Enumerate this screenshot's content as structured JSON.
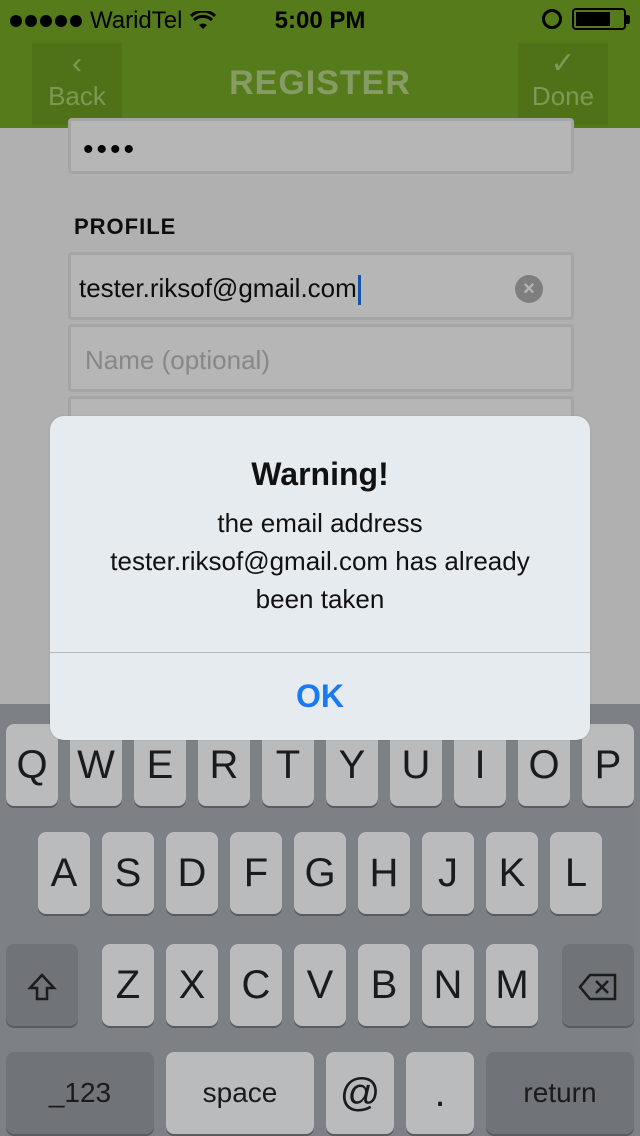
{
  "status_bar": {
    "carrier": "WaridTel",
    "time": "5:00 PM"
  },
  "nav": {
    "back_label": "Back",
    "title": "REGISTER",
    "done_label": "Done"
  },
  "form": {
    "password_masked": "••••",
    "section_title": "PROFILE",
    "email_value": "tester.riksof@gmail.com",
    "name_placeholder": "Name (optional)"
  },
  "alert": {
    "title": "Warning!",
    "message": "the email address tester.riksof@gmail.com has already been taken",
    "ok_label": "OK"
  },
  "keyboard": {
    "row1": [
      "Q",
      "W",
      "E",
      "R",
      "T",
      "Y",
      "U",
      "I",
      "O",
      "P"
    ],
    "row2": [
      "A",
      "S",
      "D",
      "F",
      "G",
      "H",
      "J",
      "K",
      "L"
    ],
    "row3": [
      "Z",
      "X",
      "C",
      "V",
      "B",
      "N",
      "M"
    ],
    "row4": {
      "numbers": "_123",
      "space": "space",
      "at": "@",
      "dot": ".",
      "return": "return"
    }
  },
  "colors": {
    "nav_green": "#6b9a22",
    "alert_button": "#1a7af5"
  }
}
